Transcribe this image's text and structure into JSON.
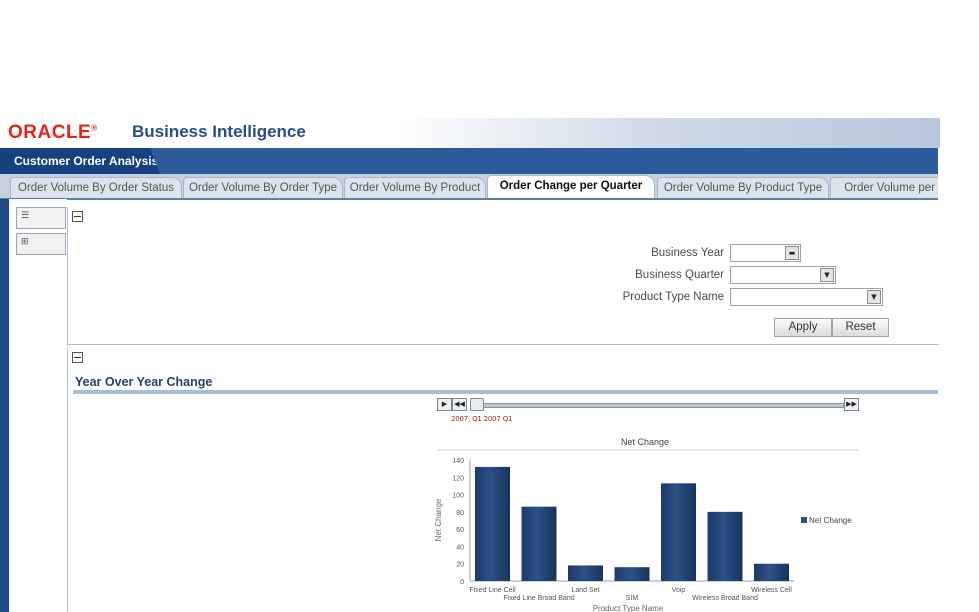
{
  "header": {
    "logo_text": "ORACLE",
    "product_title": "Business Intelligence"
  },
  "dashboard": {
    "name": "Customer Order Analysis"
  },
  "tabs": [
    {
      "label": "Order Volume By Order Status",
      "active": false
    },
    {
      "label": "Order Volume By Order Type",
      "active": false
    },
    {
      "label": "Order Volume By Product",
      "active": false
    },
    {
      "label": "Order Change per Quarter",
      "active": true
    },
    {
      "label": "Order Volume By Product Type",
      "active": false
    },
    {
      "label": "Order Volume per M",
      "active": false
    }
  ],
  "prompts": {
    "business_year_label": "Business Year",
    "business_year_value": "",
    "business_quarter_label": "Business Quarter",
    "business_quarter_value": "",
    "product_type_label": "Product Type Name",
    "product_type_value": "",
    "apply_label": "Apply",
    "reset_label": "Reset"
  },
  "section": {
    "title": "Year Over Year Change"
  },
  "slider": {
    "value_label": "2007, Q1 2007 Q1",
    "play_glyph": "▶",
    "prev_glyph": "◀◀",
    "next_glyph": "▶▶"
  },
  "chart_data": {
    "type": "bar",
    "title": "Net Change",
    "xlabel": "Product Type Name",
    "ylabel": "Net Change",
    "categories": [
      "Fixed Line Cell",
      "Fixed Line Broad Band",
      "Land Set",
      "SIM",
      "Voip",
      "Wireless Broad Band",
      "Wireless Cell"
    ],
    "series": [
      {
        "name": "Net Change",
        "values": [
          132,
          86,
          18,
          16,
          113,
          80,
          20
        ],
        "color": "#2c5184"
      }
    ],
    "ylim": [
      0,
      140
    ],
    "yticks": [
      "140",
      "120",
      "100",
      "80",
      "60",
      "40",
      "20",
      "0"
    ],
    "grid": false,
    "legend": "right"
  },
  "colors": {
    "accent": "#1f4a86",
    "brand": "#e0261c",
    "bar": "#2c5184"
  }
}
